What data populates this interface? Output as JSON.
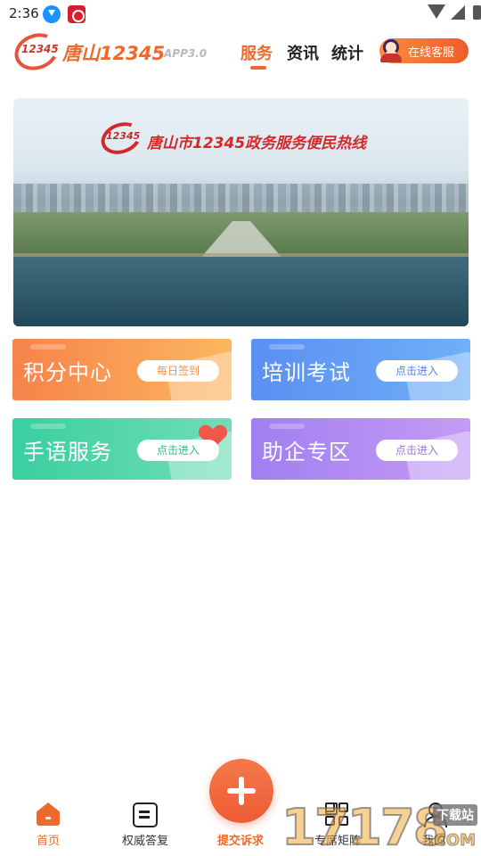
{
  "status_bar": {
    "time": "2:36"
  },
  "header": {
    "logo_text": "12345",
    "app_title": "唐山12345",
    "app_version": "APP3.0",
    "tabs": [
      {
        "label": "服务",
        "active": true
      },
      {
        "label": "资讯",
        "active": false
      },
      {
        "label": "统计",
        "active": false
      }
    ],
    "online_service_label": "在线客服"
  },
  "banner": {
    "logo_text": "12345",
    "title": "唐山市12345政务服务便民热线"
  },
  "cards": [
    {
      "title": "积分中心",
      "button": "每日签到"
    },
    {
      "title": "培训考试",
      "button": "点击进入"
    },
    {
      "title": "手语服务",
      "button": "点击进入"
    },
    {
      "title": "助企专区",
      "button": "点击进入"
    }
  ],
  "bottom_nav": [
    {
      "label": "首页",
      "icon": "home-icon",
      "active": true
    },
    {
      "label": "权威答复",
      "icon": "answers-icon",
      "active": false
    },
    {
      "label": "提交诉求",
      "icon": "plus-icon",
      "active": false
    },
    {
      "label": "专席矩阵",
      "icon": "grid-icon",
      "active": false
    },
    {
      "label": "我的",
      "icon": "user-icon",
      "active": false
    }
  ],
  "watermark": {
    "number": "17178",
    "badge": "下载站",
    "domain": ".COM"
  },
  "colors": {
    "accent": "#ee6a2c",
    "card_points": "#f7834a",
    "card_training": "#5b8ff2",
    "card_sign": "#39cfa0",
    "card_biz": "#a07ff0"
  }
}
